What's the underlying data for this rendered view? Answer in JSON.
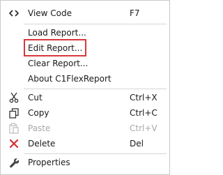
{
  "menu": {
    "items": [
      {
        "label": "View Code",
        "shortcut": "F7",
        "icon": "code-brackets-icon"
      },
      {
        "label": "Load Report...",
        "shortcut": ""
      },
      {
        "label": "Edit Report...",
        "shortcut": ""
      },
      {
        "label": "Clear Report...",
        "shortcut": ""
      },
      {
        "label": "About C1FlexReport",
        "shortcut": ""
      },
      {
        "label": "Cut",
        "shortcut": "Ctrl+X",
        "icon": "scissors-icon"
      },
      {
        "label": "Copy",
        "shortcut": "Ctrl+C",
        "icon": "copy-icon"
      },
      {
        "label": "Paste",
        "shortcut": "Ctrl+V",
        "icon": "paste-icon",
        "disabled": true
      },
      {
        "label": "Delete",
        "shortcut": "Del",
        "icon": "delete-x-icon"
      },
      {
        "label": "Properties",
        "shortcut": "",
        "icon": "wrench-icon"
      }
    ]
  },
  "colors": {
    "highlight_border": "#d9373b",
    "delete_icon": "#d32f2f",
    "disabled_text": "#a8a8a8"
  }
}
